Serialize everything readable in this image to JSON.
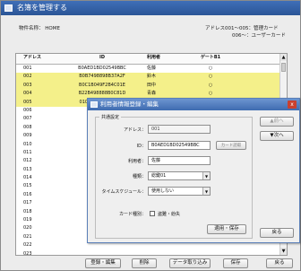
{
  "window": {
    "title": "名簿を管理する"
  },
  "info": {
    "unit_name": "物件名称：  HOME",
    "address_note_1": "アドレス001～005：管理カード",
    "address_note_2": "006～：ユーザーカード"
  },
  "table": {
    "headers": {
      "address": "アドレス",
      "id": "ID",
      "name": "利用者",
      "gate": "ゲートB1"
    },
    "rows": [
      {
        "address": "001",
        "id": "B0AED1BD02549BBC",
        "name": "佐藤",
        "gate": "○",
        "selected": false
      },
      {
        "address": "002",
        "id": "B0B7498898B37A2F",
        "name": "鈴木",
        "gate": "○",
        "selected": true
      },
      {
        "address": "003",
        "id": "B0C1B049F2B4C01E",
        "name": "田中",
        "gate": "○",
        "selected": true
      },
      {
        "address": "004",
        "id": "B22B498888B0C81D",
        "name": "青森",
        "gate": "○",
        "selected": true
      },
      {
        "address": "005",
        "id": "0100000000000711",
        "name": "",
        "gate": "○",
        "selected": true
      },
      {
        "address": "006",
        "id": "",
        "name": "",
        "gate": "",
        "selected": false
      },
      {
        "address": "007",
        "id": "",
        "name": "",
        "gate": "",
        "selected": false
      },
      {
        "address": "008",
        "id": "",
        "name": "",
        "gate": "",
        "selected": false
      },
      {
        "address": "009",
        "id": "",
        "name": "",
        "gate": "",
        "selected": false
      },
      {
        "address": "010",
        "id": "",
        "name": "",
        "gate": "",
        "selected": false
      },
      {
        "address": "011",
        "id": "",
        "name": "",
        "gate": "",
        "selected": false
      },
      {
        "address": "012",
        "id": "",
        "name": "",
        "gate": "",
        "selected": false
      },
      {
        "address": "013",
        "id": "",
        "name": "",
        "gate": "",
        "selected": false
      },
      {
        "address": "014",
        "id": "",
        "name": "",
        "gate": "",
        "selected": false
      },
      {
        "address": "015",
        "id": "",
        "name": "",
        "gate": "",
        "selected": false
      },
      {
        "address": "016",
        "id": "",
        "name": "",
        "gate": "",
        "selected": false
      },
      {
        "address": "017",
        "id": "",
        "name": "",
        "gate": "",
        "selected": false
      },
      {
        "address": "018",
        "id": "",
        "name": "",
        "gate": "",
        "selected": false
      },
      {
        "address": "019",
        "id": "",
        "name": "",
        "gate": "",
        "selected": false
      },
      {
        "address": "020",
        "id": "",
        "name": "",
        "gate": "",
        "selected": false
      },
      {
        "address": "021",
        "id": "",
        "name": "",
        "gate": "",
        "selected": false
      },
      {
        "address": "022",
        "id": "",
        "name": "",
        "gate": "",
        "selected": false
      },
      {
        "address": "023",
        "id": "",
        "name": "",
        "gate": "",
        "selected": false
      }
    ]
  },
  "bottom_buttons": {
    "register_edit": "登録・編集",
    "delete": "削除",
    "import": "データ取り込み",
    "save": "保存",
    "close": "戻る"
  },
  "dialog": {
    "title": "利用者情報登録・編集",
    "section_label": "共通設定",
    "address_label": "アドレス：",
    "address_value": "001",
    "id_label": "ID：",
    "id_value": "B0AED1BD02549BBC",
    "card_read_button": "カード読取",
    "user_label": "利用者：",
    "user_value": "佐藤",
    "type_label": "種類：",
    "type_value": "総鍵01",
    "schedule_label": "タイムスケジュール：",
    "schedule_value": "使用しない",
    "card_status_label": "カード種別：",
    "card_status_option": "盗難・紛失",
    "apply_save_button": "適用・保存",
    "prev_button": "▲前へ",
    "next_button": "▼次へ",
    "back_button": "戻る",
    "close_icon_text": "x"
  }
}
